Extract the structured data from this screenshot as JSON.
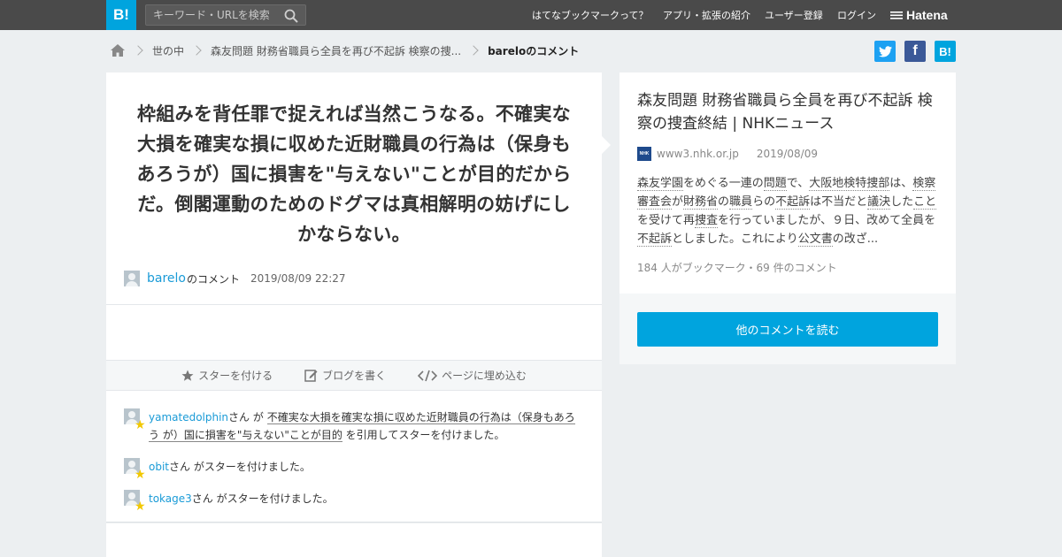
{
  "header": {
    "logo": "B!",
    "search_placeholder": "キーワード・URLを検索",
    "nav": [
      "はてなブックマークって？",
      "アプリ・拡張の紹介",
      "ユーザー登録",
      "ログイン"
    ],
    "brand": "Hatena"
  },
  "breadcrumb": {
    "items": [
      "世の中",
      "森友問題 財務省職員ら全員を再び不起訴 検察の捜..."
    ],
    "current": "bareloのコメント"
  },
  "share": {
    "twitter": "t",
    "facebook": "f",
    "hatena": "B!"
  },
  "comment": {
    "text": "枠組みを背任罪で捉えれば当然こうなる。不確実な大損を確実な損に収めた近財職員の行為は（保身もあろうが）国に損害を\"与えない\"ことが目的だからだ。倒閣運動のためのドグマは真相解明の妨げにしかならない。",
    "user": "barelo",
    "user_suffix": "のコメント",
    "date": "2019/08/09 22:27"
  },
  "actions": {
    "star": "スターを付ける",
    "blog": "ブログを書く",
    "embed": "ページに埋め込む"
  },
  "stars": [
    {
      "user": "yamatedolphin",
      "pre": "さん が ",
      "quote": "不確実な大損を確実な損に収めた近財職員の行為は（保身もあろう が）国に損害を\"与えない\"ことが目的",
      "post": " を引用してスターを付けました。"
    },
    {
      "user": "obit",
      "text": "さん がスターを付けました。"
    },
    {
      "user": "tokage3",
      "text": "さん がスターを付けました。"
    }
  ],
  "entry": {
    "title": "森友問題 財務省職員ら全員を再び不起訴 検察の捜査終結 | NHKニュース",
    "favicon_label": "NHK",
    "domain": "www3.nhk.or.jp",
    "date": "2019/08/09",
    "summary": [
      {
        "t": "森友学園",
        "k": true
      },
      {
        "t": "をめぐる一連の",
        "k": false
      },
      {
        "t": "問題",
        "k": true
      },
      {
        "t": "で、",
        "k": false
      },
      {
        "t": "大阪地検特捜部",
        "k": true
      },
      {
        "t": "は、",
        "k": false
      },
      {
        "t": "検察審査会",
        "k": true
      },
      {
        "t": "が",
        "k": false
      },
      {
        "t": "財務省",
        "k": true
      },
      {
        "t": "の",
        "k": false
      },
      {
        "t": "職員",
        "k": true
      },
      {
        "t": "らの",
        "k": false
      },
      {
        "t": "不起訴",
        "k": true
      },
      {
        "t": "は不当だと",
        "k": false
      },
      {
        "t": "議決",
        "k": true
      },
      {
        "t": "した",
        "k": false
      },
      {
        "t": "こと",
        "k": true
      },
      {
        "t": "を受けて再",
        "k": false
      },
      {
        "t": "捜査",
        "k": true
      },
      {
        "t": "を行っていましたが、９日、改めて全員を",
        "k": false
      },
      {
        "t": "不起訴",
        "k": true
      },
      {
        "t": "としました。これにより",
        "k": false
      },
      {
        "t": "公文書",
        "k": true
      },
      {
        "t": "の改ざ...",
        "k": false
      }
    ],
    "counts": "184 人がブックマーク・69 件のコメント",
    "more_button": "他のコメントを読む"
  },
  "colors": {
    "accent": "#00a4de",
    "link": "#1a9bd7",
    "star": "#f2c800",
    "twitter": "#1da1f2",
    "facebook": "#3b5998"
  }
}
